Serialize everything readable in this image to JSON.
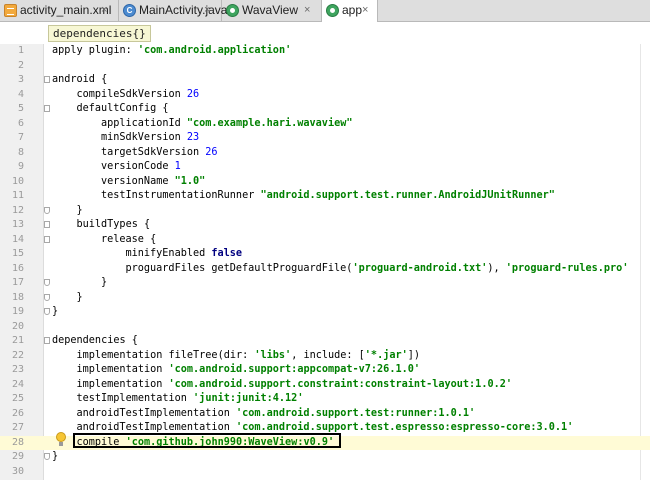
{
  "tabs": [
    {
      "label": "activity_main.xml",
      "icon": "xml-file-icon",
      "active": false
    },
    {
      "label": "MainActivity.java",
      "icon": "java-class-icon",
      "active": false
    },
    {
      "label": "WavaView",
      "icon": "gradle-module-icon",
      "active": false
    },
    {
      "label": "app",
      "icon": "gradle-module-icon",
      "active": true
    }
  ],
  "tab_close_glyph": "×",
  "class_icon_letter": "C",
  "breadcrumb": "dependencies{}",
  "editor": {
    "caret_line": 28,
    "highlighted_line": 28,
    "lines": [
      {
        "n": "1",
        "indent": 0,
        "parts": [
          [
            "p",
            "apply plugin: "
          ],
          [
            "s",
            "'com.android.application'"
          ]
        ]
      },
      {
        "n": "2",
        "indent": 0,
        "parts": []
      },
      {
        "n": "3",
        "indent": 0,
        "fold": "start",
        "parts": [
          [
            "p",
            "android {"
          ]
        ]
      },
      {
        "n": "4",
        "indent": 1,
        "parts": [
          [
            "p",
            "compileSdkVersion "
          ],
          [
            "n",
            "26"
          ]
        ]
      },
      {
        "n": "5",
        "indent": 1,
        "fold": "start",
        "parts": [
          [
            "p",
            "defaultConfig {"
          ]
        ]
      },
      {
        "n": "6",
        "indent": 2,
        "parts": [
          [
            "p",
            "applicationId "
          ],
          [
            "s",
            "\"com.example.hari.wavaview\""
          ]
        ]
      },
      {
        "n": "7",
        "indent": 2,
        "parts": [
          [
            "p",
            "minSdkVersion "
          ],
          [
            "n",
            "23"
          ]
        ]
      },
      {
        "n": "8",
        "indent": 2,
        "parts": [
          [
            "p",
            "targetSdkVersion "
          ],
          [
            "n",
            "26"
          ]
        ]
      },
      {
        "n": "9",
        "indent": 2,
        "parts": [
          [
            "p",
            "versionCode "
          ],
          [
            "n",
            "1"
          ]
        ]
      },
      {
        "n": "10",
        "indent": 2,
        "parts": [
          [
            "p",
            "versionName "
          ],
          [
            "s",
            "\"1.0\""
          ]
        ]
      },
      {
        "n": "11",
        "indent": 2,
        "parts": [
          [
            "p",
            "testInstrumentationRunner "
          ],
          [
            "s",
            "\"android.support.test.runner.AndroidJUnitRunner\""
          ]
        ]
      },
      {
        "n": "12",
        "indent": 1,
        "fold": "end",
        "parts": [
          [
            "p",
            "}"
          ]
        ]
      },
      {
        "n": "13",
        "indent": 1,
        "fold": "start",
        "parts": [
          [
            "p",
            "buildTypes {"
          ]
        ]
      },
      {
        "n": "14",
        "indent": 2,
        "fold": "start",
        "parts": [
          [
            "p",
            "release {"
          ]
        ]
      },
      {
        "n": "15",
        "indent": 3,
        "parts": [
          [
            "p",
            "minifyEnabled "
          ],
          [
            "k",
            "false"
          ]
        ]
      },
      {
        "n": "16",
        "indent": 3,
        "parts": [
          [
            "p",
            "proguardFiles getDefaultProguardFile("
          ],
          [
            "s",
            "'proguard-android.txt'"
          ],
          [
            "p",
            "), "
          ],
          [
            "s",
            "'proguard-rules.pro'"
          ]
        ]
      },
      {
        "n": "17",
        "indent": 2,
        "fold": "end",
        "parts": [
          [
            "p",
            "}"
          ]
        ]
      },
      {
        "n": "18",
        "indent": 1,
        "fold": "end",
        "parts": [
          [
            "p",
            "}"
          ]
        ]
      },
      {
        "n": "19",
        "indent": 0,
        "fold": "end",
        "parts": [
          [
            "p",
            "}"
          ]
        ]
      },
      {
        "n": "20",
        "indent": 0,
        "parts": []
      },
      {
        "n": "21",
        "indent": 0,
        "fold": "start",
        "parts": [
          [
            "p",
            "dependencies {"
          ]
        ]
      },
      {
        "n": "22",
        "indent": 1,
        "parts": [
          [
            "p",
            "implementation fileTree(dir: "
          ],
          [
            "s",
            "'libs'"
          ],
          [
            "p",
            ", include: ["
          ],
          [
            "s",
            "'*.jar'"
          ],
          [
            "p",
            "])"
          ]
        ]
      },
      {
        "n": "23",
        "indent": 1,
        "parts": [
          [
            "p",
            "implementation "
          ],
          [
            "s",
            "'com.android.support:appcompat-v7:26.1.0'"
          ]
        ]
      },
      {
        "n": "24",
        "indent": 1,
        "parts": [
          [
            "p",
            "implementation "
          ],
          [
            "s",
            "'com.android.support.constraint:constraint-layout:1.0.2'"
          ]
        ]
      },
      {
        "n": "25",
        "indent": 1,
        "parts": [
          [
            "p",
            "testImplementation "
          ],
          [
            "s",
            "'junit:junit:4.12'"
          ]
        ]
      },
      {
        "n": "26",
        "indent": 1,
        "parts": [
          [
            "p",
            "androidTestImplementation "
          ],
          [
            "s",
            "'com.android.support.test:runner:1.0.1'"
          ]
        ]
      },
      {
        "n": "27",
        "indent": 1,
        "parts": [
          [
            "p",
            "androidTestImplementation "
          ],
          [
            "s",
            "'com.android.support.test.espresso:espresso-core:3.0.1'"
          ]
        ]
      },
      {
        "n": "28",
        "indent": 1,
        "parts": [
          [
            "p",
            "compile "
          ],
          [
            "s",
            "'com.github.john990:WaveView:v0.9'"
          ]
        ]
      },
      {
        "n": "29",
        "indent": 0,
        "fold": "end",
        "parts": [
          [
            "p",
            "}"
          ]
        ]
      },
      {
        "n": "30",
        "indent": 0,
        "parts": []
      }
    ]
  },
  "colors": {
    "string": "#008000",
    "number": "#0000ff",
    "keyword": "#000080",
    "caret_row": "#fffbd6",
    "highlight_box": "#000000"
  }
}
